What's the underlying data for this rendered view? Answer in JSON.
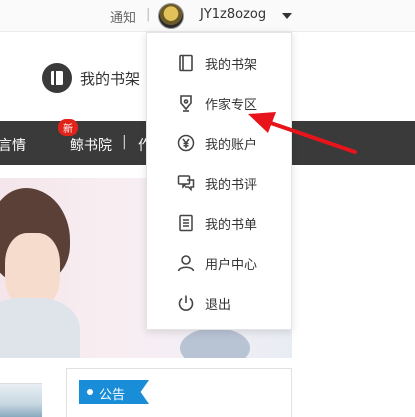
{
  "topbar": {
    "notice": "通知",
    "separator": "|",
    "username": "JY1z8ozog"
  },
  "header": {
    "shelf_label": "我的书架"
  },
  "nav": {
    "items": [
      {
        "label": "言情"
      },
      {
        "label": "鲸书院",
        "badge": "新"
      },
      {
        "label": "|"
      },
      {
        "label": "作"
      }
    ]
  },
  "notice_section": {
    "label": "公告"
  },
  "dropdown": {
    "items": [
      {
        "label": "我的书架",
        "icon": "book-icon"
      },
      {
        "label": "作家专区",
        "icon": "pen-icon"
      },
      {
        "label": "我的账户",
        "icon": "yuan-icon"
      },
      {
        "label": "我的书评",
        "icon": "comment-icon"
      },
      {
        "label": "我的书单",
        "icon": "list-icon"
      },
      {
        "label": "用户中心",
        "icon": "user-icon"
      },
      {
        "label": "退出",
        "icon": "power-icon"
      }
    ]
  },
  "colors": {
    "nav_bg": "#3a3a3a",
    "badge": "#e2231a",
    "notice_tab": "#1a8dd8",
    "annotation_arrow": "#e8141b"
  }
}
